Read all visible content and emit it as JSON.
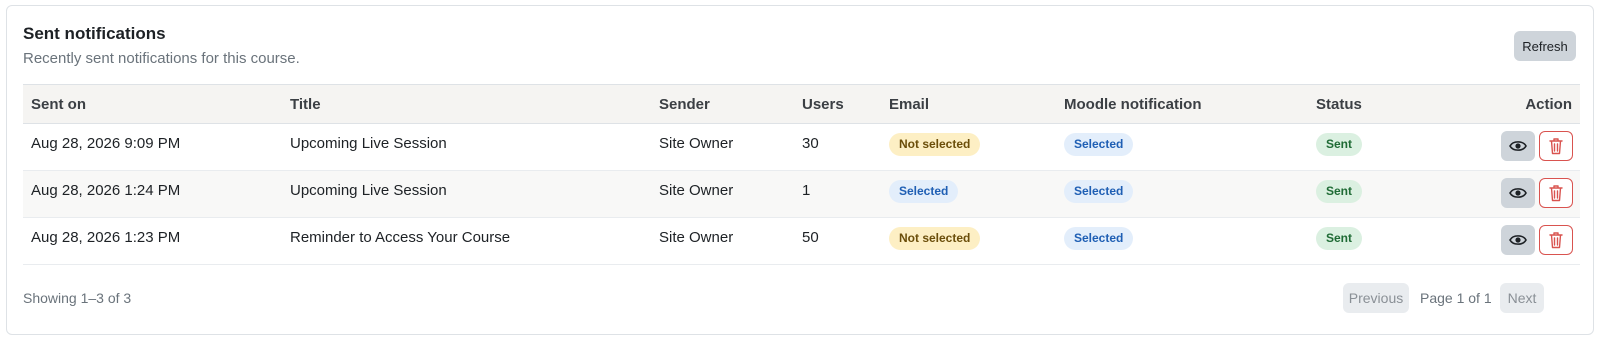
{
  "card": {
    "title": "Sent notifications",
    "subtitle": "Recently sent notifications for this course.",
    "refresh_label": "Refresh"
  },
  "table": {
    "headers": {
      "sent_on": "Sent on",
      "title": "Title",
      "sender": "Sender",
      "users": "Users",
      "email": "Email",
      "moodle": "Moodle notification",
      "status": "Status",
      "action": "Action"
    },
    "rows": [
      {
        "sent_on": "Aug 28, 2026 9:09 PM",
        "title": "Upcoming Live Session",
        "sender": "Site Owner",
        "users": "30",
        "email": "Not selected",
        "moodle": "Selected",
        "status": "Sent"
      },
      {
        "sent_on": "Aug 28, 2026 1:24 PM",
        "title": "Upcoming Live Session",
        "sender": "Site Owner",
        "users": "1",
        "email": "Selected",
        "moodle": "Selected",
        "status": "Sent"
      },
      {
        "sent_on": "Aug 28, 2026 1:23 PM",
        "title": "Reminder to Access Your Course",
        "sender": "Site Owner",
        "users": "50",
        "email": "Not selected",
        "moodle": "Selected",
        "status": "Sent"
      }
    ]
  },
  "pagination": {
    "showing": "Showing 1–3 of 3",
    "previous_label": "Previous",
    "page_label": "Page 1 of 1",
    "next_label": "Next"
  },
  "icons": {
    "view": "eye-icon",
    "delete": "trash-icon"
  },
  "colors": {
    "danger": "#d9534f",
    "badge_warning_bg": "#fdefc4",
    "badge_info_bg": "#e3eefb",
    "badge_success_bg": "#dbf0e1"
  }
}
